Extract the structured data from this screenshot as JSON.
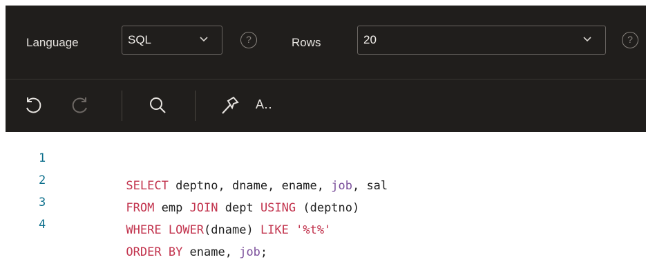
{
  "toolbar": {
    "language_label": "Language",
    "language_value": "SQL",
    "rows_label": "Rows",
    "rows_value": "20",
    "help_glyph": "?",
    "format_label": "A‥",
    "icons": [
      "undo-icon",
      "redo-icon",
      "search-icon",
      "hammer-icon",
      "format-text-icon"
    ]
  },
  "editor": {
    "lines": [
      {
        "num": "1",
        "tokens": [
          {
            "t": "SELECT",
            "c": "kw"
          },
          {
            "t": " deptno, dname, ename, ",
            "c": ""
          },
          {
            "t": "job",
            "c": "id2"
          },
          {
            "t": ", sal",
            "c": ""
          }
        ]
      },
      {
        "num": "2",
        "tokens": [
          {
            "t": "FROM",
            "c": "kw"
          },
          {
            "t": " emp ",
            "c": ""
          },
          {
            "t": "JOIN",
            "c": "kw"
          },
          {
            "t": " dept ",
            "c": ""
          },
          {
            "t": "USING",
            "c": "kw"
          },
          {
            "t": " (deptno)",
            "c": ""
          }
        ]
      },
      {
        "num": "3",
        "tokens": [
          {
            "t": "WHERE",
            "c": "kw"
          },
          {
            "t": " ",
            "c": ""
          },
          {
            "t": "LOWER",
            "c": "fn"
          },
          {
            "t": "(dname) ",
            "c": ""
          },
          {
            "t": "LIKE",
            "c": "kw"
          },
          {
            "t": " ",
            "c": ""
          },
          {
            "t": "'%t%'",
            "c": "str"
          }
        ]
      },
      {
        "num": "4",
        "tokens": [
          {
            "t": "ORDER BY",
            "c": "kw"
          },
          {
            "t": " ename, ",
            "c": ""
          },
          {
            "t": "job",
            "c": "id2"
          },
          {
            "t": ";",
            "c": ""
          }
        ]
      }
    ]
  },
  "colors": {
    "toolbar_bg": "#201e1c",
    "keyword": "#c2334d",
    "identifier2": "#7b4f9b",
    "line_number": "#0c6f8c"
  }
}
